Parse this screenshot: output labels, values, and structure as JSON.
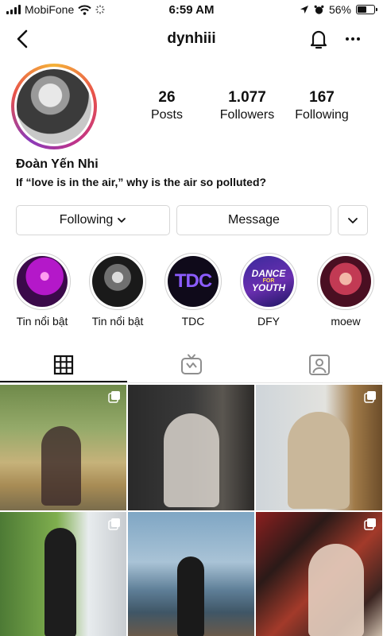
{
  "status_bar": {
    "carrier": "MobiFone",
    "time": "6:59 AM",
    "battery": "56%",
    "battery_level": 0.56
  },
  "header": {
    "username": "dynhiii",
    "icons": [
      "back-arrow-icon",
      "bell-icon",
      "more-icon"
    ]
  },
  "profile": {
    "stats": [
      {
        "value": "26",
        "label": "Posts"
      },
      {
        "value": "1.077",
        "label": "Followers"
      },
      {
        "value": "167",
        "label": "Following"
      }
    ],
    "full_name": "Đoàn Yến Nhi",
    "bio": "If “love is in the air,” why is the air so polluted?"
  },
  "actions": {
    "following_label": "Following",
    "message_label": "Message"
  },
  "highlights": [
    {
      "label": "Tin nổi bật"
    },
    {
      "label": "Tin nổi bật"
    },
    {
      "label": "TDC",
      "cover_text": "TDC"
    },
    {
      "label": "DFY",
      "cover_lines": [
        "DANCE",
        "FOR",
        "YOUTH"
      ]
    },
    {
      "label": "moew"
    }
  ],
  "tabs": [
    "grid-icon",
    "igtv-icon",
    "tagged-icon"
  ],
  "posts": [
    {
      "multi": true
    },
    {
      "multi": false
    },
    {
      "multi": true
    },
    {
      "multi": true
    },
    {
      "multi": false
    },
    {
      "multi": true
    }
  ],
  "colors": {
    "ring_gradient": [
      "#f5b338",
      "#e8524a",
      "#c23386",
      "#8a3ab9"
    ],
    "border": "#d6d6d6",
    "text": "#111111"
  }
}
